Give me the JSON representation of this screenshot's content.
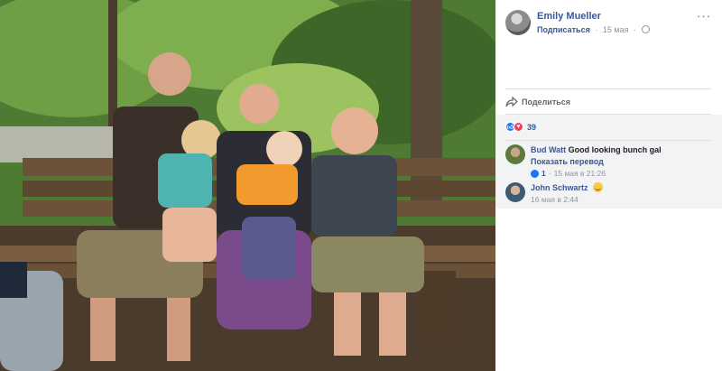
{
  "photo": {
    "description_icon": "family-photo-icon"
  },
  "post": {
    "author": "Emily Mueller",
    "subscribe_label": "Подписаться",
    "separator": "·",
    "date": "15 мая",
    "privacy_icon": "globe-icon",
    "more_label": "···"
  },
  "actions": {
    "share_label": "Поделиться",
    "share_icon": "share-icon"
  },
  "reactions": {
    "count": "39",
    "icons": [
      "like-icon",
      "love-icon"
    ]
  },
  "comments": [
    {
      "author": "Bud Watt",
      "text": "Good looking bunch gal",
      "translate_label": "Показать перевод",
      "likes": "1",
      "time": "15 мая в 21:26"
    },
    {
      "author": "John Schwartz",
      "emoji": "smile-icon",
      "time": "16 мая в 2:44"
    }
  ],
  "colors": {
    "link": "#385898",
    "meta": "#90949c",
    "like": "#1877f2",
    "love": "#f33e58",
    "comment_bg": "#f2f3f5"
  }
}
